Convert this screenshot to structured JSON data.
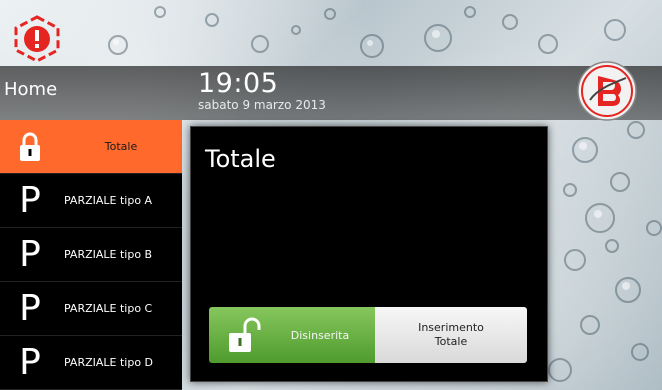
{
  "header": {
    "home_label": "Home",
    "time": "19:05",
    "date": "sabato 9 marzo 2013"
  },
  "icons": {
    "alarm": "alarm-warning-icon",
    "logo": "brand-logo-icon",
    "padlock_closed": "padlock-closed-icon",
    "padlock_open": "padlock-open-icon"
  },
  "scenarios": [
    {
      "icon": "padlock",
      "label": "Totale",
      "active": true
    },
    {
      "icon": "P",
      "label": "PARZIALE tipo A",
      "active": false
    },
    {
      "icon": "P",
      "label": "PARZIALE tipo B",
      "active": false
    },
    {
      "icon": "P",
      "label": "PARZIALE tipo C",
      "active": false
    },
    {
      "icon": "P",
      "label": "PARZIALE tipo D",
      "active": false
    }
  ],
  "dialog": {
    "title": "Totale",
    "disarm_label": "Disinserita",
    "arm_label_line1": "Inserimento",
    "arm_label_line2": "Totale"
  },
  "colors": {
    "accent_orange": "#ff6a2c",
    "disarm_green": "#5fae3a",
    "alarm_red": "#e52521"
  }
}
